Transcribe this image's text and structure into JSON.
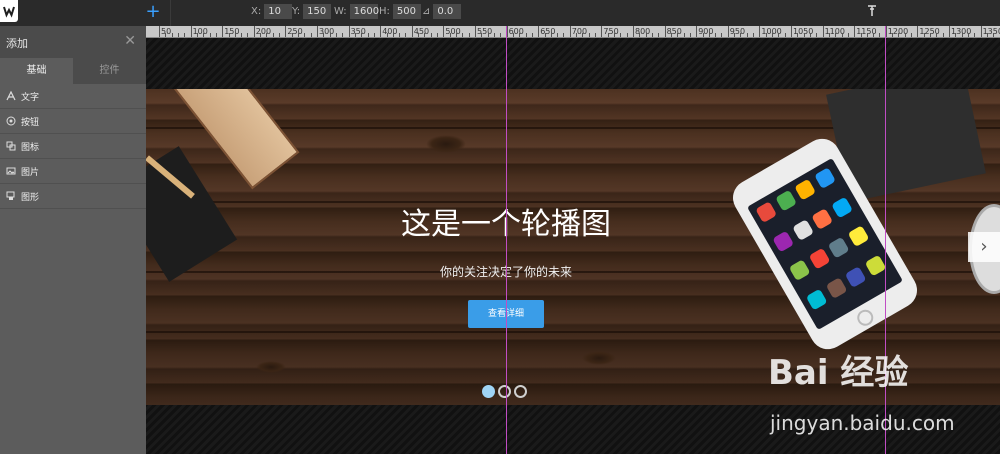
{
  "toolbar": {
    "add_icon": "plus-icon",
    "coords": [
      {
        "label": "X:",
        "value": "10"
      },
      {
        "label": "Y:",
        "value": "150"
      },
      {
        "label": "W:",
        "value": "1600"
      },
      {
        "label": "H:",
        "value": "500"
      },
      {
        "label": "⊿",
        "value": "0.0"
      }
    ]
  },
  "panel": {
    "title": "添加",
    "tabs": [
      {
        "label": "基础",
        "active": true
      },
      {
        "label": "控件",
        "active": false
      }
    ],
    "items": [
      {
        "label": "文字",
        "icon": "text-icon"
      },
      {
        "label": "按钮",
        "icon": "button-icon"
      },
      {
        "label": "图标",
        "icon": "icon-icon"
      },
      {
        "label": "图片",
        "icon": "image-icon"
      },
      {
        "label": "图形",
        "icon": "shape-icon"
      }
    ]
  },
  "ruler": {
    "labels": [
      "50",
      "100",
      "150",
      "200",
      "250",
      "300",
      "350",
      "400",
      "450",
      "500",
      "550",
      "600",
      "650",
      "700",
      "750",
      "800",
      "850",
      "900",
      "950",
      "1000",
      "1050",
      "1100",
      "1150",
      "1200",
      "1250",
      "1300",
      "1350"
    ]
  },
  "slide": {
    "title": "这是一个轮播图",
    "subtitle": "你的关注决定了你的未来",
    "button_label": "查看详细",
    "button_color": "#3a9de8",
    "dot_count": 3,
    "active_dot": 0,
    "next_arrow": "›"
  },
  "watermark": {
    "main": "Bai 经验",
    "url": "jingyan.baidu.com"
  },
  "colors": {
    "guide": "#c04dc4",
    "accent": "#3aa0ff"
  }
}
